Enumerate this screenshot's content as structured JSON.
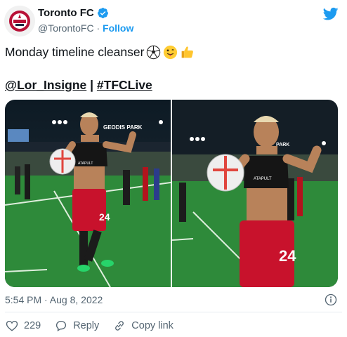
{
  "account": {
    "display_name": "Toronto FC",
    "handle": "@TorontoFC",
    "separator": "·",
    "follow_label": "Follow"
  },
  "tweet": {
    "text": "Monday timeline cleanser",
    "emojis": [
      "soccer-ball-emoji",
      "tongue-face-emoji",
      "thumbs-up-emoji"
    ],
    "mention": "@Lor_Insigne",
    "mention_separator": "|",
    "hashtag": "#TFCLive"
  },
  "media": {
    "photos": [
      {
        "name": "photo-left",
        "jersey_number": "24",
        "stadium_sign": "GEODIS PARK",
        "sponsor": "ATAPULT"
      },
      {
        "name": "photo-right",
        "jersey_number": "24",
        "stadium_sign": "PARK",
        "sponsor": "ATAPULT"
      }
    ]
  },
  "footer": {
    "timestamp": "5:54 PM · Aug 8, 2022",
    "like_count": "229",
    "reply_label": "Reply",
    "copy_link_label": "Copy link"
  },
  "colors": {
    "brand_blue": "#1d9bf0",
    "tfc_red": "#b81137",
    "muted_text": "#536471"
  }
}
